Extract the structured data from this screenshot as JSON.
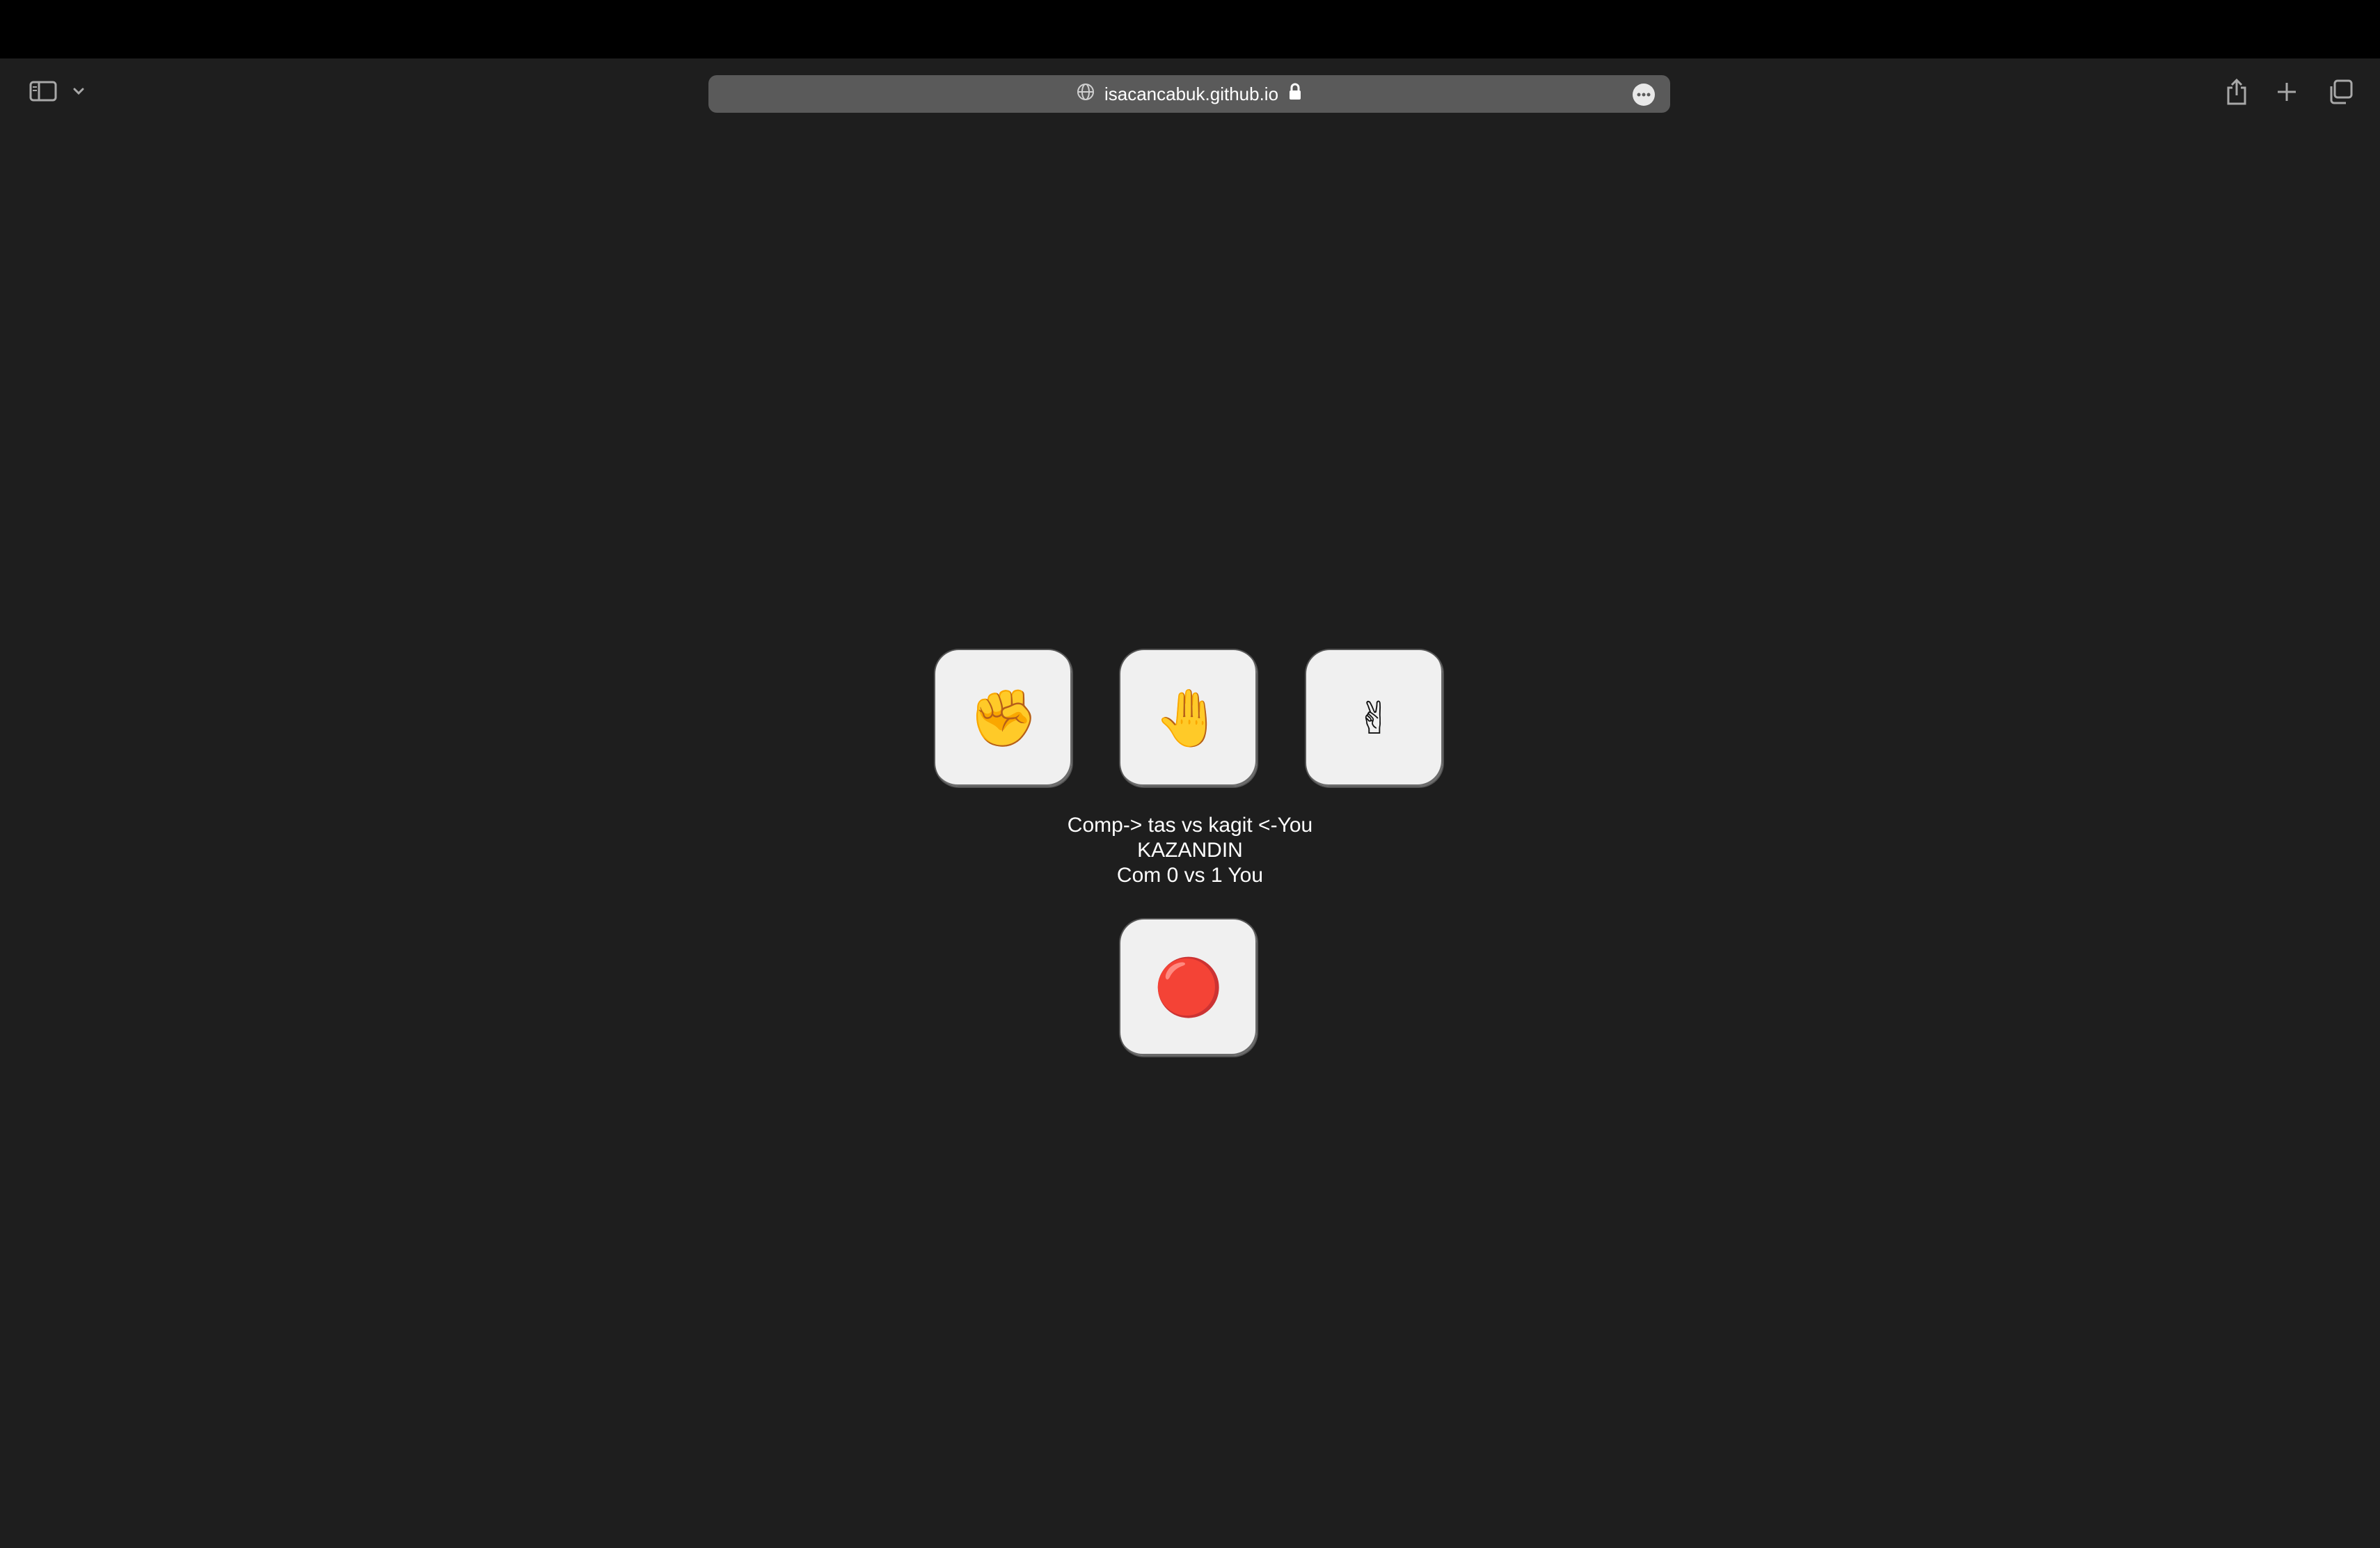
{
  "browser": {
    "url": "isacancabuk.github.io",
    "icons": {
      "sidebar": "sidebar-icon",
      "chevron": "chevron-down-icon",
      "globe": "globe-icon",
      "lock": "lock-icon",
      "more": "ellipsis-icon",
      "share": "share-icon",
      "new_tab": "plus-icon",
      "tabs": "tabs-overview-icon"
    }
  },
  "game": {
    "choices": [
      {
        "name": "rock",
        "emoji": "✊"
      },
      {
        "name": "paper",
        "emoji": "🤚"
      },
      {
        "name": "scissors",
        "emoji": "✌"
      }
    ],
    "result_line1": "Comp-> tas vs kagit <-You",
    "result_line2": "KAZANDIN",
    "result_line3": "Com 0 vs 1 You",
    "reset_emoji": "🔴"
  },
  "colors": {
    "page_background": "#1e1e1e",
    "button_face": "#f0f0f0",
    "address_bar": "#5a5a5a"
  }
}
